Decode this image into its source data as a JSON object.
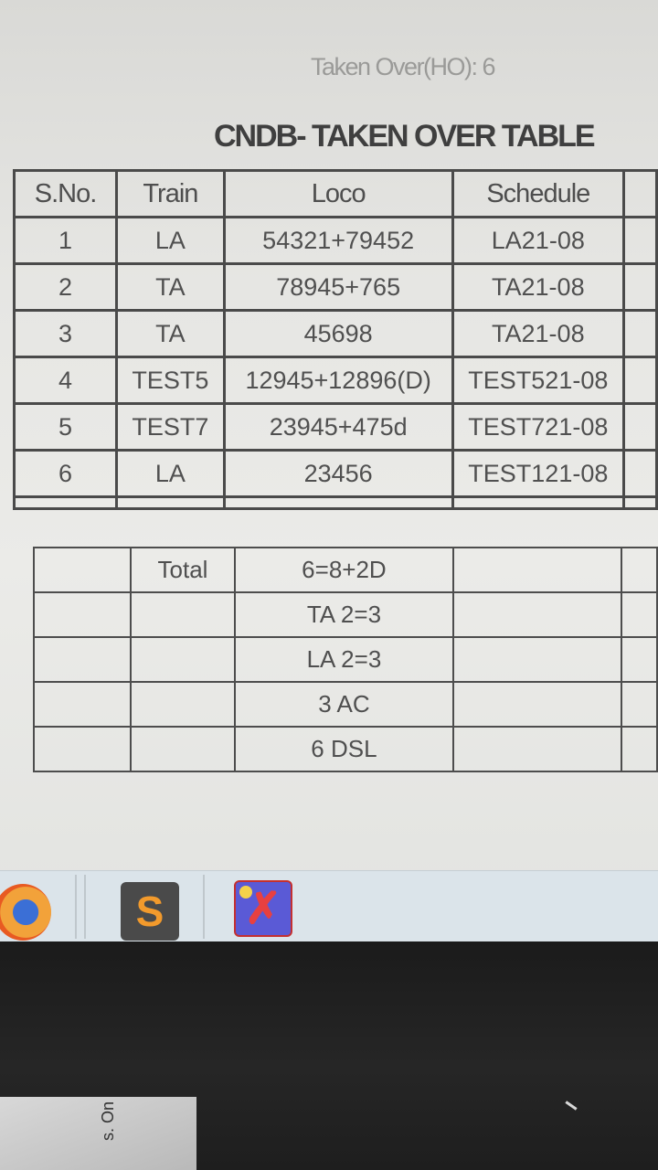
{
  "window": {
    "subtitle": "Taken Over(HO): 6",
    "title": "CNDB- TAKEN OVER TABLE"
  },
  "table": {
    "headers": [
      "S.No.",
      "Train",
      "Loco",
      "Schedule"
    ],
    "rows": [
      [
        "1",
        "LA",
        "54321+79452",
        "LA21-08"
      ],
      [
        "2",
        "TA",
        "78945+765",
        "TA21-08"
      ],
      [
        "3",
        "TA",
        "45698",
        "TA21-08"
      ],
      [
        "4",
        "TEST5",
        "12945+12896(D)",
        "TEST521-08"
      ],
      [
        "5",
        "TEST7",
        "23945+475d",
        "TEST721-08"
      ],
      [
        "6",
        "LA",
        "23456",
        "TEST121-08"
      ]
    ]
  },
  "summary": {
    "label": "Total",
    "lines": [
      "6=8+2D",
      "TA 2=3",
      "LA 2=3",
      "3 AC",
      "6 DSL"
    ]
  },
  "taskbar": {
    "items": [
      {
        "icon": "firefox-icon"
      },
      {
        "icon": "sublime-text-icon",
        "glyph": "S"
      },
      {
        "icon": "xapp-icon",
        "glyph": "✗"
      }
    ]
  },
  "desk": {
    "paper_text": "s. On"
  }
}
